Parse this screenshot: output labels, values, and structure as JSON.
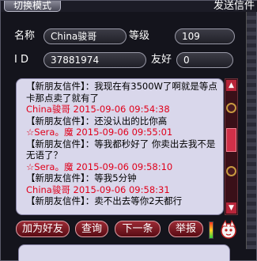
{
  "header": {
    "mode_tab": "切换模式",
    "title": "发送信件"
  },
  "fields": {
    "name_label": "名称",
    "name_value": "China骏哥",
    "level_label": "等级",
    "level_value": "109",
    "id_label": "I D",
    "id_value": "37881974",
    "friend_label": "友好",
    "friend_value": "0"
  },
  "messages": [
    {
      "text": "【新朋友信件】：我现在有3500W了啊就是等点卡那点卖了就有了",
      "kind": "msg"
    },
    {
      "text": "China骏哥  2015-09-06 09:54:38",
      "kind": "meta"
    },
    {
      "text": "【新朋友信件】：还没认出的比你高",
      "kind": "msg"
    },
    {
      "text": "☆Sera。魔  2015-09-06 09:55:01",
      "kind": "meta"
    },
    {
      "text": "【新朋友信件】：等我都秒好了 你卖出去我不是无语了？",
      "kind": "msg"
    },
    {
      "text": "☆Sera。魔  2015-09-06 09:58:10",
      "kind": "meta"
    },
    {
      "text": "【新朋友信件】：等我5分钟",
      "kind": "msg"
    },
    {
      "text": "China骏哥  2015-09-06 09:58:31",
      "kind": "meta"
    },
    {
      "text": "【新朋友信件】：卖不出去等你2天都行",
      "kind": "msg"
    }
  ],
  "buttons": {
    "add_friend": "加为好友",
    "query": "查询",
    "next": "下一条",
    "report": "举报"
  },
  "colors": {
    "meta_text": "#e0001b",
    "chat_bg": "#d9d7eb",
    "button": "#7a1a24"
  }
}
